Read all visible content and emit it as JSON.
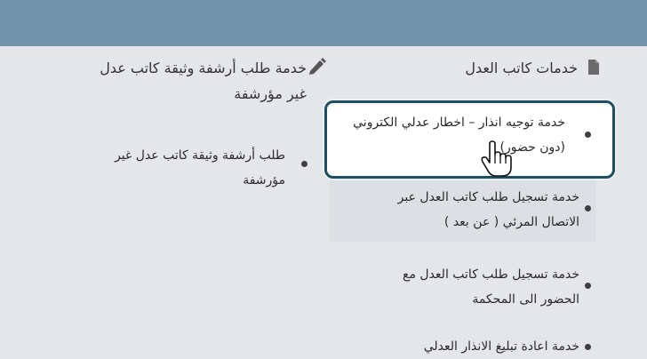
{
  "right_column": {
    "title": "خدمات كاتب العدل",
    "items": [
      {
        "line1": "خدمة توجيه انذار – اخطار عدلي الكتروني",
        "line2": "(دون حضور)"
      },
      {
        "line1": "خدمة تسجيل طلب كاتب العدل عبر",
        "line2": "الاتصال المرئي ( عن بعد )"
      },
      {
        "line1": "خدمة تسجيل طلب كاتب العدل مع",
        "line2": "الحضور الى المحكمة"
      },
      {
        "line1": "خدمة اعادة تبليغ الانذار العدلي",
        "line2": ""
      }
    ]
  },
  "left_column": {
    "title_line1": "خدمة طلب أرشفة وثيقة كاتب عدل",
    "title_line2": "غير مؤرشفة",
    "items": [
      {
        "line1": "طلب أرشفة وثيقة كاتب عدل غير",
        "line2": "مؤرشفة"
      }
    ]
  },
  "colors": {
    "topbar": "#7394a9",
    "background": "#e4e6e9",
    "highlight_border": "#1d4f62"
  },
  "icons": {
    "right_title_icon": "document-icon",
    "left_title_icon": "pencil-icon",
    "cursor_icon": "hand-pointer-icon"
  }
}
